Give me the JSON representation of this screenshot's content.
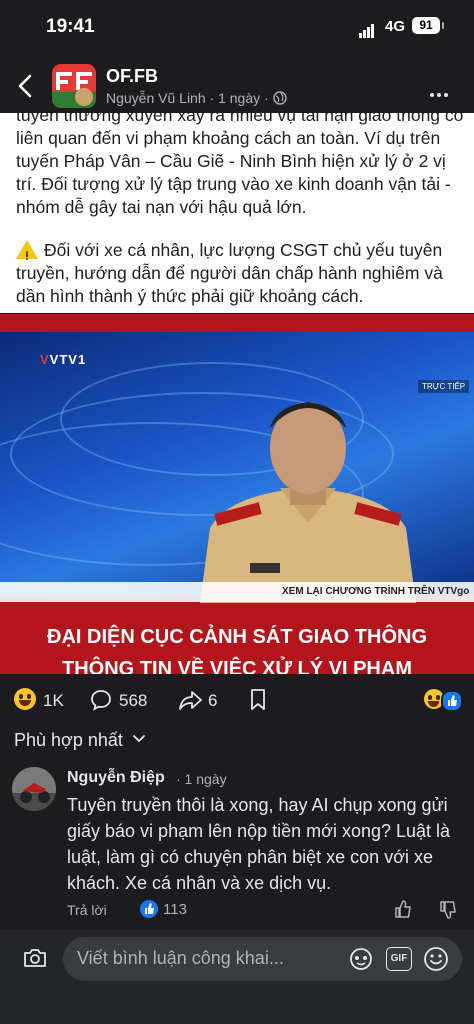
{
  "status_bar": {
    "time": "19:41",
    "network": "4G",
    "battery": "91"
  },
  "header": {
    "page_name": "OF.FB",
    "author": "Nguyễn Vũ Linh",
    "separator": "·",
    "time_ago": "1 ngày",
    "separator2": "·"
  },
  "post": {
    "paragraph1": "tuyến thường xuyên xảy ra nhiều vụ tai nạn giao thông có liên quan đến vi phạm khoảng cách an toàn. Ví dụ trên tuyến Pháp Vân – Cầu Giẽ - Ninh Bình hiện xử lý ở 2 vị trí. Đối tượng xử lý tập trung vào xe kinh doanh vận tải - nhóm dễ gây tai nạn với hậu quả lớn.",
    "paragraph2": "Đối với xe cá nhân, lực lượng CSGT chủ yếu tuyên truyền, hướng dẫn để người dân chấp hành nghiêm và dần hình thành ý thức phải giữ khoảng cách."
  },
  "media": {
    "channel_logo": "VTV1",
    "live_label": "TRỰC TIẾP",
    "ticker": "XEM LẠI CHƯƠNG TRÌNH TRÊN VTVgo",
    "headline_line1": "ĐẠI DIỆN CỤC CẢNH SÁT GIAO THÔNG",
    "headline_line2": "THÔNG TIN VỀ VIỆC XỬ LÝ VI PHẠM"
  },
  "actions": {
    "reactions": "1K",
    "comments": "568",
    "shares": "6"
  },
  "sort": {
    "label": "Phù hợp nhất"
  },
  "comment": {
    "author": "Nguyễn Điệp",
    "time_ago": "· 1 ngày",
    "text": "Tuyên truyền thôi là xong, hay AI chụp xong gửi giấy báo vi phạm lên nộp tiền mới xong? Luật là luật, làm gì có chuyện phân biệt xe con với xe khách. Xe cá nhân và xe dịch vụ.",
    "reply_label": "Trả lời",
    "likes": "113"
  },
  "composer": {
    "placeholder": "Viết bình luận công khai...",
    "gif_label": "GIF"
  },
  "colors": {
    "background": "#1c1c1e",
    "accent": "#1877f2",
    "media_red": "#b2151b"
  }
}
